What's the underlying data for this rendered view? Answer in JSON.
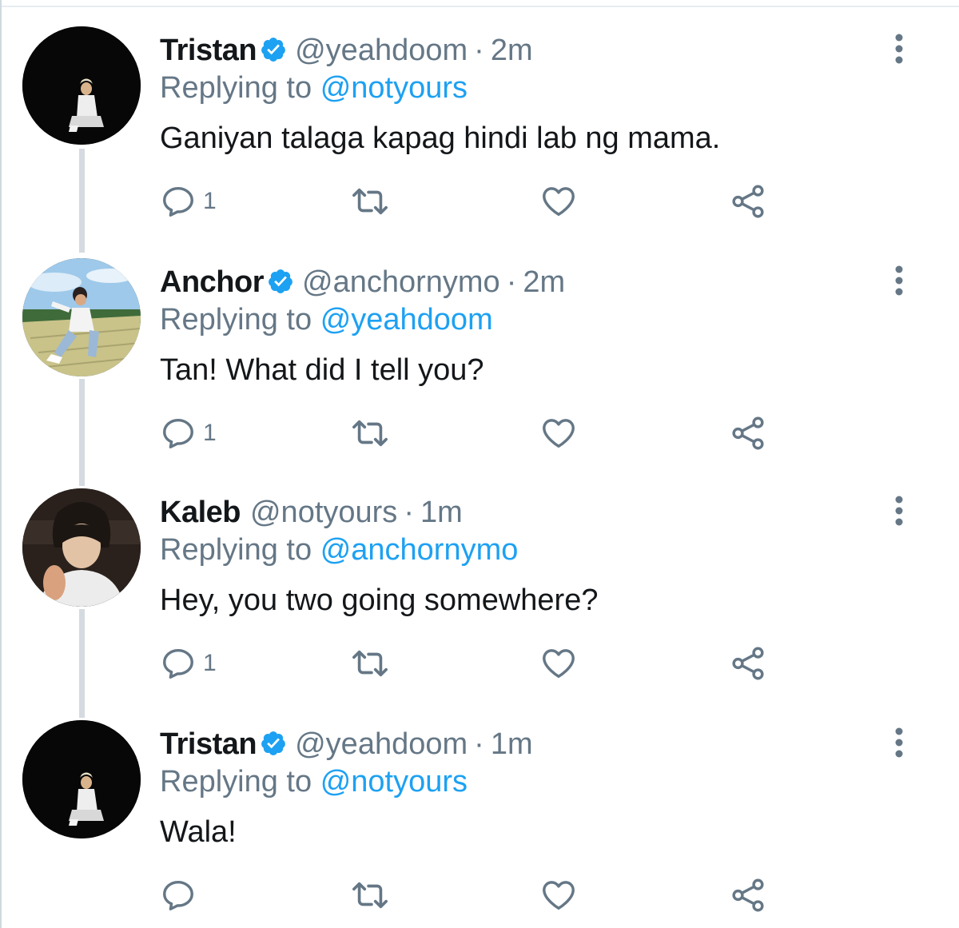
{
  "tweets": [
    {
      "name": "Tristan",
      "verified": true,
      "handle": "@yeahdoom",
      "separator": "·",
      "time": "2m",
      "replying_prefix": "Replying to",
      "replying_to": "@notyours",
      "text": "Ganiyan talaga kapag hindi lab ng mama.",
      "reply_count": "1",
      "avatar": "dark-person-avatar"
    },
    {
      "name": "Anchor",
      "verified": true,
      "handle": "@anchornymo",
      "separator": "·",
      "time": "2m",
      "replying_prefix": "Replying to",
      "replying_to": "@yeahdoom",
      "text": "Tan! What did I tell you?",
      "reply_count": "1",
      "avatar": "sky-rooftop-person-avatar"
    },
    {
      "name": "Kaleb",
      "verified": false,
      "handle": "@notyours",
      "separator": "·",
      "time": "1m",
      "replying_prefix": "Replying to",
      "replying_to": "@anchornymo",
      "text": "Hey, you two going somewhere?",
      "reply_count": "1",
      "avatar": "portrait-person-avatar"
    },
    {
      "name": "Tristan",
      "verified": true,
      "handle": "@yeahdoom",
      "separator": "·",
      "time": "1m",
      "replying_prefix": "Replying to",
      "replying_to": "@notyours",
      "text": "Wala!",
      "reply_count": "",
      "avatar": "dark-person-avatar"
    }
  ],
  "colors": {
    "text": "#14171a",
    "secondary": "#657786",
    "link": "#1da1f2",
    "verified": "#1da1f2",
    "thread_line": "#d5dbe0"
  },
  "icons": {
    "reply": "reply-icon",
    "retweet": "retweet-icon",
    "like": "heart-icon",
    "share": "share-icon",
    "more": "more-vertical-icon",
    "verified": "verified-badge-icon"
  }
}
